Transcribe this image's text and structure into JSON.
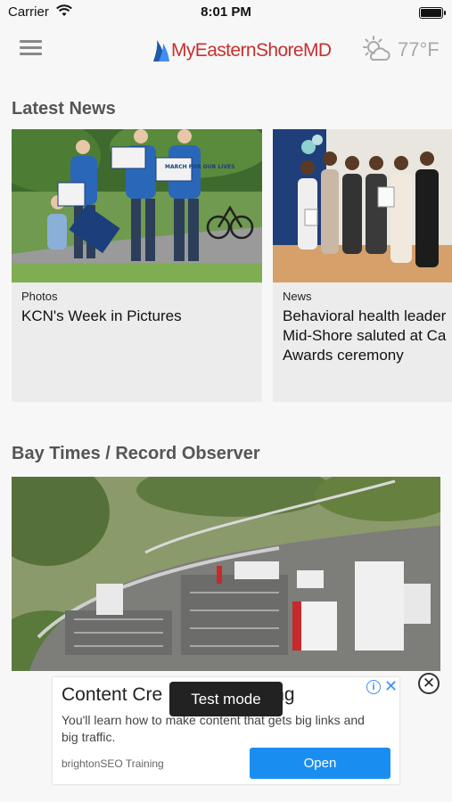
{
  "status_bar": {
    "carrier": "Carrier",
    "time": "8:01 PM"
  },
  "header": {
    "logo_text": "MyEasternShoreMD",
    "weather": {
      "icon": "partly-cloudy-icon",
      "temperature": "77°F"
    },
    "menu_icon": "hamburger-icon"
  },
  "latest_news": {
    "title": "Latest News",
    "cards": [
      {
        "category": "Photos",
        "headline": "KCN's Week in Pictures",
        "sign_text": [
          "MARCH FOR OUR LIVES"
        ]
      },
      {
        "category": "News",
        "headline_lines": [
          "Behavioral health leader",
          "Mid-Shore saluted at Ca",
          "Awards ceremony"
        ]
      }
    ]
  },
  "bay_times": {
    "title": "Bay Times / Record Observer"
  },
  "ad": {
    "title": "Content Cre",
    "title_tail": "ng",
    "description": "You'll learn how to make content that gets big links and big traffic.",
    "advertiser": "brightonSEO Training",
    "button": "Open",
    "info_icon": "info-icon",
    "close_icon": "close-icon"
  },
  "toast": {
    "text": "Test mode"
  },
  "colors": {
    "brand": "#c7302f",
    "accent": "#1a8ef0",
    "section_title": "#555555"
  }
}
